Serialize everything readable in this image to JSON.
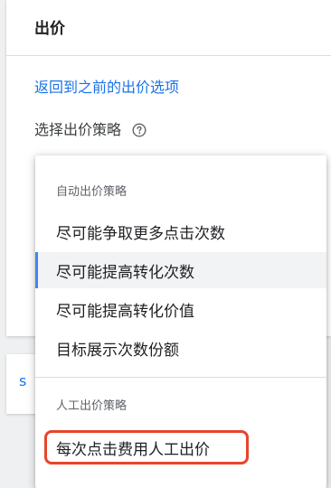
{
  "panel": {
    "title": "出价",
    "back_link": "返回到之前的出价选项",
    "strategy_label": "选择出价策略",
    "help_icon": "help-circle-icon"
  },
  "behind_card": {
    "partial_text": "s"
  },
  "dropdown": {
    "groups": [
      {
        "header": "自动出价策略",
        "options": [
          {
            "label": "尽可能争取更多点击次数",
            "selected": false
          },
          {
            "label": "尽可能提高转化次数",
            "selected": true
          },
          {
            "label": "尽可能提高转化价值",
            "selected": false
          },
          {
            "label": "目标展示次数份额",
            "selected": false
          }
        ]
      },
      {
        "header": "人工出价策略",
        "options": [
          {
            "label": "每次点击费用人工出价",
            "selected": false,
            "highlighted": true
          }
        ]
      }
    ]
  },
  "colors": {
    "link": "#1a73e8",
    "selected_indicator": "#4285f4",
    "highlight_border": "#e8442c"
  }
}
